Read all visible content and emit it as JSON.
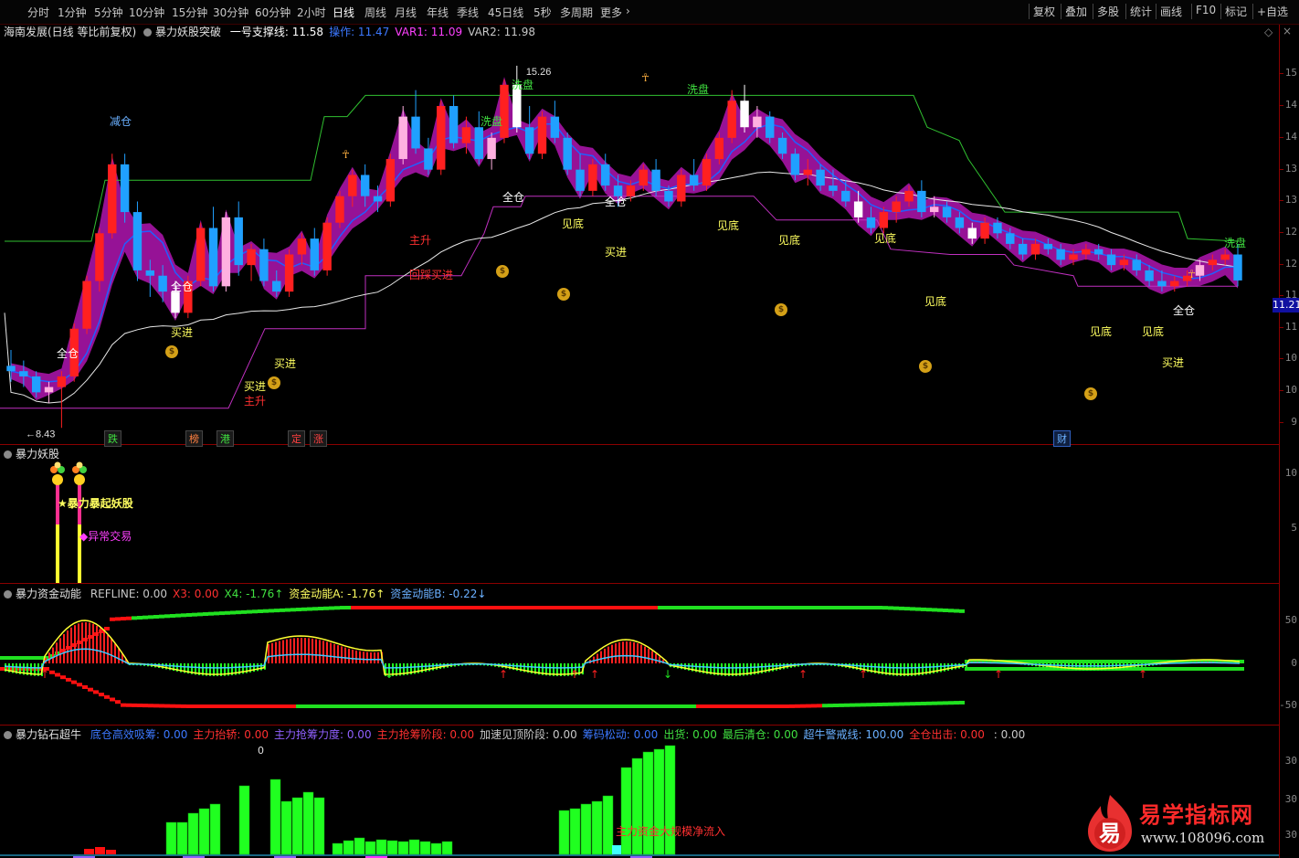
{
  "toolbar": {
    "periods": [
      "分时",
      "1分钟",
      "5分钟",
      "10分钟",
      "15分钟",
      "30分钟",
      "60分钟",
      "2小时",
      "日线",
      "周线",
      "月线",
      "年线",
      "季线",
      "45日线",
      "5秒",
      "多周期",
      "更多"
    ],
    "active_period": "日线",
    "more_arrow": "›",
    "right_buttons": [
      "复权",
      "叠加",
      "多股",
      "统计",
      "画线",
      "F10",
      "标记",
      "+自选"
    ],
    "nav_arrows": [
      "‹",
      "›"
    ]
  },
  "main_panel": {
    "title": "海南发展(日线 等比前复权)",
    "indicator": "暴力妖股突破",
    "fields": [
      {
        "label": "一号支撑线:",
        "value": "11.58",
        "color": "#ffffff"
      },
      {
        "label": "操作:",
        "value": "11.47",
        "color": "#3c78ff"
      },
      {
        "label": "VAR1:",
        "value": "11.09",
        "color": "#ff40ff"
      },
      {
        "label": "VAR2:",
        "value": "11.98",
        "color": "#c8c8c8"
      }
    ],
    "high_label": "15.26",
    "low_label": "←8.43",
    "price_tag": "11.21",
    "axis_labels": [
      "15",
      "14",
      "14",
      "13",
      "13",
      "12",
      "12",
      "11",
      "11",
      "10",
      "10",
      "9"
    ],
    "signals": [
      {
        "text": "减仓",
        "color": "#6ab0ff"
      },
      {
        "text": "洗盘",
        "color": "#40e040"
      },
      {
        "text": "洗盘",
        "color": "#40e040"
      },
      {
        "text": "洗盘",
        "color": "#40e040"
      },
      {
        "text": "洗盘",
        "color": "#40e040"
      },
      {
        "text": "全仓",
        "color": "#ffffff"
      },
      {
        "text": "全仓",
        "color": "#ffffff"
      },
      {
        "text": "全仓",
        "color": "#ffffff"
      },
      {
        "text": "全仓",
        "color": "#ffffff"
      },
      {
        "text": "全仓",
        "color": "#ffffff"
      },
      {
        "text": "买进",
        "color": "#ffff60"
      },
      {
        "text": "买进",
        "color": "#ffff60"
      },
      {
        "text": "买进",
        "color": "#ffff60"
      },
      {
        "text": "买进",
        "color": "#ffff60"
      },
      {
        "text": "买进",
        "color": "#ffff60"
      },
      {
        "text": "主升",
        "color": "#ff3030"
      },
      {
        "text": "主升",
        "color": "#ff3030"
      },
      {
        "text": "回踩买进",
        "color": "#ff3030"
      },
      {
        "text": "见底",
        "color": "#ffff60"
      },
      {
        "text": "见底",
        "color": "#ffff60"
      },
      {
        "text": "见底",
        "color": "#ffff60"
      },
      {
        "text": "见底",
        "color": "#ffff60"
      },
      {
        "text": "见底",
        "color": "#ffff60"
      },
      {
        "text": "见底",
        "color": "#ffff60"
      },
      {
        "text": "见底",
        "color": "#ffff60"
      }
    ],
    "bottom_labels": [
      {
        "text": "跌",
        "color": "#40e040"
      },
      {
        "text": "榜",
        "color": "#ff8040"
      },
      {
        "text": "港",
        "color": "#40e040"
      },
      {
        "text": "定",
        "color": "#ff4040"
      },
      {
        "text": "涨",
        "color": "#ff4040"
      },
      {
        "text": "财",
        "color": "#6ab0ff"
      }
    ]
  },
  "panel2": {
    "title": "暴力妖股",
    "label1": "★暴力暴起妖股",
    "label2": "◆异常交易",
    "axis_labels": [
      "10",
      "5"
    ]
  },
  "panel3": {
    "title": "暴力资金动能",
    "fields": [
      {
        "label": "REFLINE:",
        "value": "0.00",
        "color": "#c8c8c8"
      },
      {
        "label": "X3:",
        "value": "0.00",
        "color": "#ff3030"
      },
      {
        "label": "X4:",
        "value": "-1.76↑",
        "color": "#40e040"
      },
      {
        "label": "资金动能A:",
        "value": "-1.76↑",
        "color": "#ffff60"
      },
      {
        "label": "资金动能B:",
        "value": "-0.22↓",
        "color": "#6ab0ff"
      }
    ],
    "axis_labels": [
      "50",
      "0",
      "-50"
    ]
  },
  "panel4": {
    "title": "暴力钻石超牛",
    "fields": [
      {
        "label": "底仓高效吸筹:",
        "value": "0.00",
        "color": "#3c78ff"
      },
      {
        "label": "主力抬轿:",
        "value": "0.00",
        "color": "#ff3030"
      },
      {
        "label": "主力抢筹力度:",
        "value": "0.00",
        "color": "#9060ff"
      },
      {
        "label": "主力抢筹阶段:",
        "value": "0.00",
        "color": "#ff3030"
      },
      {
        "label": "加速见顶阶段:",
        "value": "0.00",
        "color": "#c8c8c8"
      },
      {
        "label": "筹码松动:",
        "value": "0.00",
        "color": "#3c78ff"
      },
      {
        "label": "出货:",
        "value": "0.00",
        "color": "#40e040"
      },
      {
        "label": "最后清仓:",
        "value": "0.00",
        "color": "#40e040"
      },
      {
        "label": "超牛警戒线:",
        "value": "100.00",
        "color": "#6ab0ff"
      },
      {
        "label": "全仓出击:",
        "value": "0.00",
        "color": "#ff3030"
      },
      {
        "label": "",
        "value": ": 0.00",
        "color": "#c8c8c8"
      }
    ],
    "zero_label": "0",
    "inflow_label": "主力资金大规模净流入",
    "axis_labels": [
      "30",
      "30",
      "30"
    ]
  },
  "watermark": {
    "logo_char": "易",
    "title": "易学指标网",
    "url": "www.108096.com"
  },
  "colors": {
    "up": "#ff2020",
    "down": "#20a0ff",
    "pink": "#ffb0e0",
    "magenta": "#e020e0",
    "teal": "#106080",
    "green": "#20ff20",
    "red": "#ff1010",
    "yellow": "#ffff30",
    "white": "#ffffff"
  },
  "chart_data": {
    "type": "candlestick",
    "y_range": [
      8.4,
      15.5
    ],
    "candles": [
      [
        9.6,
        9.9,
        9.3,
        9.5
      ],
      [
        9.5,
        9.7,
        9.2,
        9.4
      ],
      [
        9.4,
        9.5,
        9.0,
        9.1
      ],
      [
        9.1,
        9.3,
        8.9,
        9.2
      ],
      [
        9.2,
        9.5,
        8.43,
        9.4
      ],
      [
        9.4,
        10.4,
        9.3,
        10.3
      ],
      [
        10.3,
        11.3,
        10.2,
        11.2
      ],
      [
        11.2,
        12.2,
        11.0,
        12.1
      ],
      [
        12.1,
        13.6,
        12.0,
        13.4
      ],
      [
        13.4,
        13.6,
        12.3,
        12.5
      ],
      [
        12.5,
        12.7,
        11.2,
        11.4
      ],
      [
        11.4,
        11.6,
        10.9,
        11.3
      ],
      [
        11.3,
        11.5,
        10.8,
        11.0
      ],
      [
        11.0,
        11.2,
        10.5,
        10.6
      ],
      [
        10.6,
        11.3,
        10.5,
        11.2
      ],
      [
        11.2,
        12.3,
        11.1,
        12.2
      ],
      [
        12.2,
        12.6,
        11.0,
        11.1
      ],
      [
        11.1,
        12.5,
        11.0,
        12.4
      ],
      [
        12.4,
        12.7,
        11.3,
        11.5
      ],
      [
        11.5,
        11.9,
        11.2,
        11.8
      ],
      [
        11.8,
        12.0,
        11.1,
        11.2
      ],
      [
        11.2,
        11.4,
        10.9,
        11.0
      ],
      [
        11.0,
        11.8,
        10.9,
        11.7
      ],
      [
        11.7,
        12.1,
        11.5,
        12.0
      ],
      [
        12.0,
        12.2,
        11.3,
        11.4
      ],
      [
        11.4,
        12.4,
        11.3,
        12.3
      ],
      [
        12.3,
        12.9,
        12.2,
        12.8
      ],
      [
        12.8,
        13.3,
        12.6,
        13.2
      ],
      [
        13.2,
        13.4,
        12.6,
        12.8
      ],
      [
        12.8,
        13.0,
        12.5,
        12.7
      ],
      [
        12.7,
        13.6,
        12.6,
        13.5
      ],
      [
        13.5,
        14.5,
        13.4,
        14.3
      ],
      [
        14.3,
        14.8,
        13.6,
        13.7
      ],
      [
        13.7,
        13.9,
        13.2,
        13.3
      ],
      [
        13.3,
        14.6,
        13.2,
        14.5
      ],
      [
        14.5,
        14.7,
        13.7,
        13.8
      ],
      [
        13.8,
        14.3,
        13.6,
        14.1
      ],
      [
        14.1,
        14.4,
        13.4,
        13.5
      ],
      [
        13.5,
        14.0,
        13.3,
        13.9
      ],
      [
        13.9,
        15.0,
        13.8,
        14.9
      ],
      [
        14.9,
        15.26,
        14.0,
        14.1
      ],
      [
        14.1,
        14.5,
        13.5,
        13.6
      ],
      [
        13.6,
        14.4,
        13.5,
        14.3
      ],
      [
        14.3,
        14.6,
        13.8,
        13.9
      ],
      [
        13.9,
        14.0,
        13.2,
        13.3
      ],
      [
        13.3,
        13.6,
        12.8,
        12.9
      ],
      [
        12.9,
        13.5,
        12.8,
        13.4
      ],
      [
        13.4,
        13.6,
        12.9,
        13.0
      ],
      [
        13.0,
        13.2,
        12.6,
        12.8
      ],
      [
        12.8,
        13.1,
        12.7,
        13.0
      ],
      [
        13.0,
        13.4,
        12.9,
        13.3
      ],
      [
        13.3,
        13.5,
        12.8,
        12.9
      ],
      [
        12.9,
        13.0,
        12.6,
        12.7
      ],
      [
        12.7,
        13.3,
        12.6,
        13.2
      ],
      [
        13.2,
        13.5,
        12.9,
        13.0
      ],
      [
        13.0,
        13.6,
        12.9,
        13.5
      ],
      [
        13.5,
        14.0,
        13.4,
        13.9
      ],
      [
        13.9,
        14.8,
        13.8,
        14.6
      ],
      [
        14.6,
        14.9,
        14.0,
        14.1
      ],
      [
        14.1,
        14.5,
        13.9,
        14.3
      ],
      [
        14.3,
        14.4,
        13.8,
        13.9
      ],
      [
        13.9,
        14.0,
        13.5,
        13.6
      ],
      [
        13.6,
        13.7,
        13.1,
        13.2
      ],
      [
        13.2,
        13.5,
        13.0,
        13.3
      ],
      [
        13.3,
        13.4,
        12.9,
        13.0
      ],
      [
        13.0,
        13.3,
        12.8,
        12.9
      ],
      [
        12.9,
        13.1,
        12.6,
        12.7
      ],
      [
        12.7,
        12.9,
        12.3,
        12.4
      ],
      [
        12.4,
        12.6,
        12.1,
        12.2
      ],
      [
        12.2,
        12.6,
        12.1,
        12.5
      ],
      [
        12.5,
        12.8,
        12.3,
        12.7
      ],
      [
        12.7,
        13.0,
        12.6,
        12.9
      ],
      [
        12.9,
        13.1,
        12.4,
        12.5
      ],
      [
        12.5,
        12.8,
        12.4,
        12.6
      ],
      [
        12.6,
        12.7,
        12.3,
        12.4
      ],
      [
        12.4,
        12.5,
        12.1,
        12.2
      ],
      [
        12.2,
        12.3,
        11.9,
        12.0
      ],
      [
        12.0,
        12.4,
        11.9,
        12.3
      ],
      [
        12.3,
        12.4,
        12.0,
        12.1
      ],
      [
        12.1,
        12.2,
        11.8,
        11.9
      ],
      [
        11.9,
        12.0,
        11.6,
        11.7
      ],
      [
        11.7,
        12.0,
        11.6,
        11.9
      ],
      [
        11.9,
        12.0,
        11.7,
        11.8
      ],
      [
        11.8,
        11.9,
        11.5,
        11.6
      ],
      [
        11.6,
        11.8,
        11.5,
        11.7
      ],
      [
        11.7,
        11.9,
        11.6,
        11.8
      ],
      [
        11.8,
        11.9,
        11.6,
        11.7
      ],
      [
        11.7,
        11.8,
        11.4,
        11.5
      ],
      [
        11.5,
        11.7,
        11.4,
        11.6
      ],
      [
        11.6,
        11.7,
        11.3,
        11.4
      ],
      [
        11.4,
        11.5,
        11.1,
        11.2
      ],
      [
        11.2,
        11.4,
        11.0,
        11.1
      ],
      [
        11.1,
        11.3,
        11.0,
        11.2
      ],
      [
        11.2,
        11.4,
        11.1,
        11.3
      ],
      [
        11.3,
        11.6,
        11.2,
        11.5
      ],
      [
        11.5,
        11.7,
        11.4,
        11.6
      ],
      [
        11.6,
        11.8,
        11.5,
        11.7
      ],
      [
        11.7,
        11.9,
        11.1,
        11.21
      ]
    ]
  }
}
